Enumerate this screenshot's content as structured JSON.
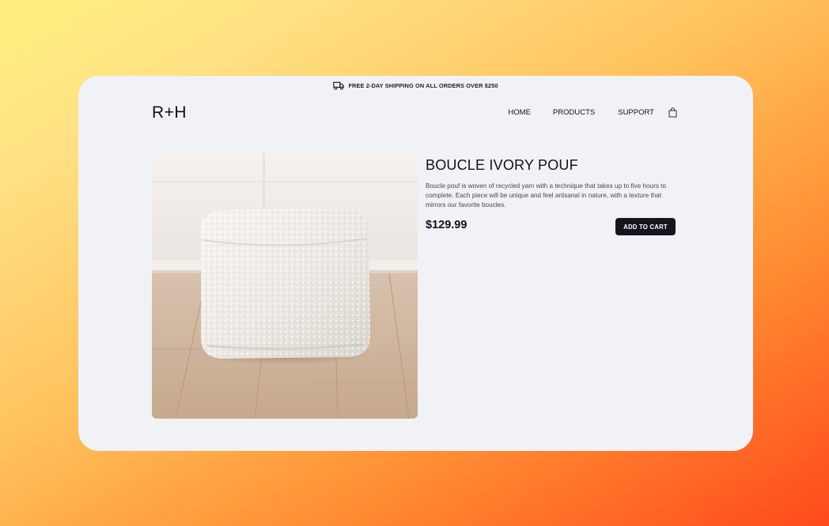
{
  "promo": {
    "text": "FREE 2-DAY SHIPPING ON ALL ORDERS OVER $250",
    "icon": "truck-icon"
  },
  "header": {
    "logo": "R+H",
    "nav": {
      "home": "HOME",
      "products": "PRODUCTS",
      "support": "SUPPORT"
    },
    "cart_icon": "shopping-bag-icon"
  },
  "product": {
    "title": "BOUCLE IVORY POUF",
    "description": "Boucle pouf is woven of recycled yarn with a technique that takes up to five hours to complete. Each piece will be unique and feel artisanal in nature, with a texture that mirrors our favorite boucles.",
    "price": "$129.99",
    "add_to_cart_label": "ADD TO CART"
  },
  "colors": {
    "card_background": "#f1f2f6",
    "button_background": "#14161f",
    "text_primary": "#10111a"
  }
}
